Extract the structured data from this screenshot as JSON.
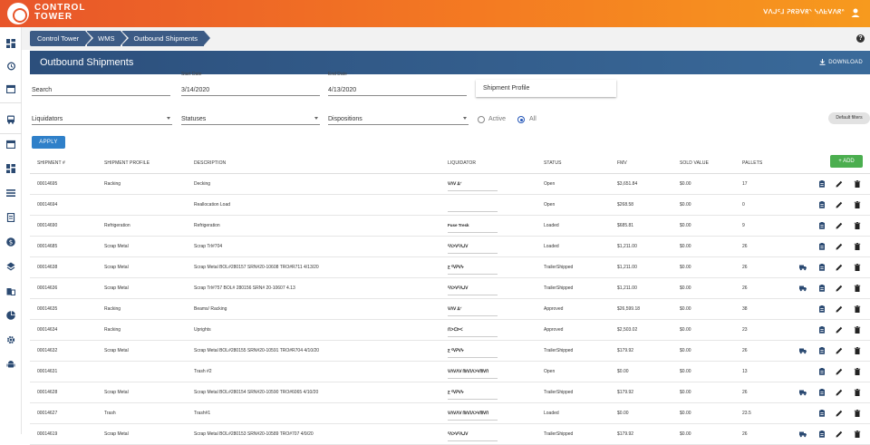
{
  "brand": {
    "line1": "CONTROL",
    "line2": "TOWER",
    "top_right_text": "ᐯᐱᒍᑦ⅃ ᕈᖇᘐᐯᖇᐠ ᓭᐱᖶᐯᐱᖇᐢ",
    "accent": "#f47a22"
  },
  "sidebar": {
    "items": [
      "dashboard-icon",
      "history-icon",
      "calendar-icon",
      "truck-icon",
      "calendar-icon",
      "grid-icon",
      "list-icon",
      "document-icon",
      "dollar-icon",
      "layers-icon",
      "building-icon",
      "pie-chart-icon",
      "gear-icon",
      "android-icon"
    ]
  },
  "breadcrumb": [
    "Control Tower",
    "WMS",
    "Outbound Shipments"
  ],
  "page": {
    "title": "Outbound Shipments",
    "download_label": "DOWNLOAD"
  },
  "filters": {
    "search": {
      "value": "Search"
    },
    "start_date": {
      "label": "Start Date",
      "value": "3/14/2020"
    },
    "end_date": {
      "label": "End Date",
      "value": "4/13/2020"
    },
    "shipment_profile": "Shipment Profile",
    "liquidators": "Liquidators",
    "statuses": "Statuses",
    "dispositions": "Dispositions",
    "active_label": "Active",
    "all_label": "All",
    "default_filters": "Default filters",
    "apply": "APPLY"
  },
  "table": {
    "add_label": "ADD",
    "headers": [
      "SHIPMENT #",
      "SHIPMENT PROFILE",
      "DESCRIPTION",
      "LIQUIDATOR",
      "STATUS",
      "FMV",
      "SOLD VALUE",
      "PALLETS"
    ],
    "rows": [
      {
        "id": "00014695",
        "profile": "Racking",
        "desc": "Decking",
        "liq": "ᐯᐱᐯ ᐃᐟ",
        "status": "Open",
        "fmv": "$3,651.84",
        "sold": "$0.00",
        "pallets": "17",
        "truck": false
      },
      {
        "id": "00014694",
        "profile": "",
        "desc": "Reallocation Load",
        "liq": "",
        "status": "Open",
        "fmv": "$268.58",
        "sold": "$0.00",
        "pallets": "0",
        "truck": false
      },
      {
        "id": "00014690",
        "profile": "Refrigeration",
        "desc": "Refrigeration",
        "liq": "Fuse Tresk",
        "status": "Loaded",
        "fmv": "$685.81",
        "sold": "$0.00",
        "pallets": "9",
        "truck": false
      },
      {
        "id": "00014685",
        "profile": "Scrap Metal",
        "desc": "Scrap Trl#704",
        "liq": "ᑦᐱᐳᐯᑦᐱᒍᐯ",
        "status": "Loaded",
        "fmv": "$1,211.00",
        "sold": "$0.00",
        "pallets": "26",
        "truck": false
      },
      {
        "id": "00014638",
        "profile": "Scrap Metal",
        "desc": "Scrap Metal BOL#280157 SRN#20-10608 TRO#R711 4/13/20",
        "liq": "Ƹ ᑦᐯᕈᐯᔭ",
        "status": "TrailerShipped",
        "fmv": "$1,211.00",
        "sold": "$0.00",
        "pallets": "26",
        "truck": true
      },
      {
        "id": "00014636",
        "profile": "Scrap Metal",
        "desc": "Scrap Trl#757 BOL# 280156 SRN# 20-10607 4.13",
        "liq": "ᑦᐱᐳᐯᑦᐱᒍᐯ",
        "status": "TrailerShipped",
        "fmv": "$1,211.00",
        "sold": "$0.00",
        "pallets": "26",
        "truck": true
      },
      {
        "id": "00014635",
        "profile": "Racking",
        "desc": "Beams/ Racking",
        "liq": "ᐯᐱᐯ ᐃᐟ",
        "status": "Approved",
        "fmv": "$26,599.18",
        "sold": "$0.00",
        "pallets": "38",
        "truck": false
      },
      {
        "id": "00014634",
        "profile": "Racking",
        "desc": "Uprights",
        "liq": "ᑎᐳᑕᐅᐸ",
        "status": "Approved",
        "fmv": "$2,503.02",
        "sold": "$0.00",
        "pallets": "23",
        "truck": false
      },
      {
        "id": "00014632",
        "profile": "Scrap Metal",
        "desc": "Scrap Metal BOL#280155 SRN#20-10591 TRO#R704 4/10/20",
        "liq": "Ƹ ᑦᐯᕈᐯᔭ",
        "status": "TrailerShipped",
        "fmv": "$179.92",
        "sold": "$0.00",
        "pallets": "26",
        "truck": true
      },
      {
        "id": "00014631",
        "profile": "",
        "desc": "Trash #2",
        "liq": "ᐯᐱᐯᐱᐯ ᗰᐱᑎᐱᐳᐯᗰᐯᑎ",
        "status": "Open",
        "fmv": "$0.00",
        "sold": "$0.00",
        "pallets": "13",
        "truck": false
      },
      {
        "id": "00014628",
        "profile": "Scrap Metal",
        "desc": "Scrap Metal BOL#280154 SRN#20-10590 TRO#6065 4/10/20",
        "liq": "Ƹ ᑦᐯᕈᐯᔭ",
        "status": "TrailerShipped",
        "fmv": "$179.92",
        "sold": "$0.00",
        "pallets": "26",
        "truck": true
      },
      {
        "id": "00014627",
        "profile": "Trash",
        "desc": "Trash#1",
        "liq": "ᐯᐱᐯᐱᐯ ᗰᐱᑎᐱᐳᐯᗰᐯᑎ",
        "status": "Loaded",
        "fmv": "$0.00",
        "sold": "$0.00",
        "pallets": "23.5",
        "truck": false
      },
      {
        "id": "00014619",
        "profile": "Scrap Metal",
        "desc": "Scrap Metal BOL#280153 SRN#20-10589 TRO#707 4/9/20",
        "liq": "ᑦᐱᐳᐯᑦᐱᒍᐯ",
        "status": "TrailerShipped",
        "fmv": "$179.92",
        "sold": "$0.00",
        "pallets": "26",
        "truck": true
      }
    ]
  }
}
